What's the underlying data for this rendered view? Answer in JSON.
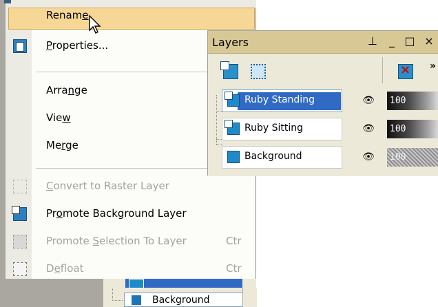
{
  "menu": {
    "items": [
      {
        "label_pre": "Renam",
        "label_key": "e",
        "label_post": "",
        "icon": "",
        "state": "highlighted"
      },
      {
        "label_pre": "",
        "label_key": "P",
        "label_post": "roperties...",
        "icon": "properties-icon",
        "state": "enabled"
      },
      {
        "label_pre": "Arra",
        "label_key": "n",
        "label_post": "ge",
        "icon": "",
        "state": "enabled"
      },
      {
        "label_pre": "Vie",
        "label_key": "w",
        "label_post": "",
        "icon": "",
        "state": "enabled"
      },
      {
        "label_pre": "Me",
        "label_key": "r",
        "label_post": "ge",
        "icon": "",
        "state": "enabled"
      },
      {
        "label_pre": "",
        "label_key": "C",
        "label_post": "onvert to Raster Layer",
        "icon": "convert-raster-icon",
        "state": "disabled"
      },
      {
        "label_pre": "Pr",
        "label_key": "o",
        "label_post": "mote Background Layer",
        "icon": "promote-background-icon",
        "state": "enabled"
      },
      {
        "label_pre": "Promote ",
        "label_key": "S",
        "label_post": "election To Layer",
        "icon": "promote-selection-icon",
        "state": "disabled",
        "shortcut": "Ctr"
      },
      {
        "label_pre": "D",
        "label_key": "e",
        "label_post": "float",
        "icon": "defloat-icon",
        "state": "disabled",
        "shortcut": "Ctr"
      }
    ]
  },
  "layers_palette": {
    "title": "Layers",
    "titlebar_buttons": [
      "pin-icon",
      "minimize-icon",
      "maximize-icon",
      "close-icon"
    ],
    "pin_glyph": "⊥",
    "minimize_glyph": "_",
    "maximize_glyph": "□",
    "close_glyph": "×",
    "more_glyph": "»",
    "layers": [
      {
        "name": "Ruby Standing",
        "opacity": "100",
        "selected": true
      },
      {
        "name": "Ruby Sitting",
        "opacity": "100",
        "selected": false
      },
      {
        "name": "Background",
        "opacity": "100",
        "selected": false
      }
    ],
    "eye_glyph": "👁"
  },
  "background_app": {
    "layer_name": "Background"
  }
}
